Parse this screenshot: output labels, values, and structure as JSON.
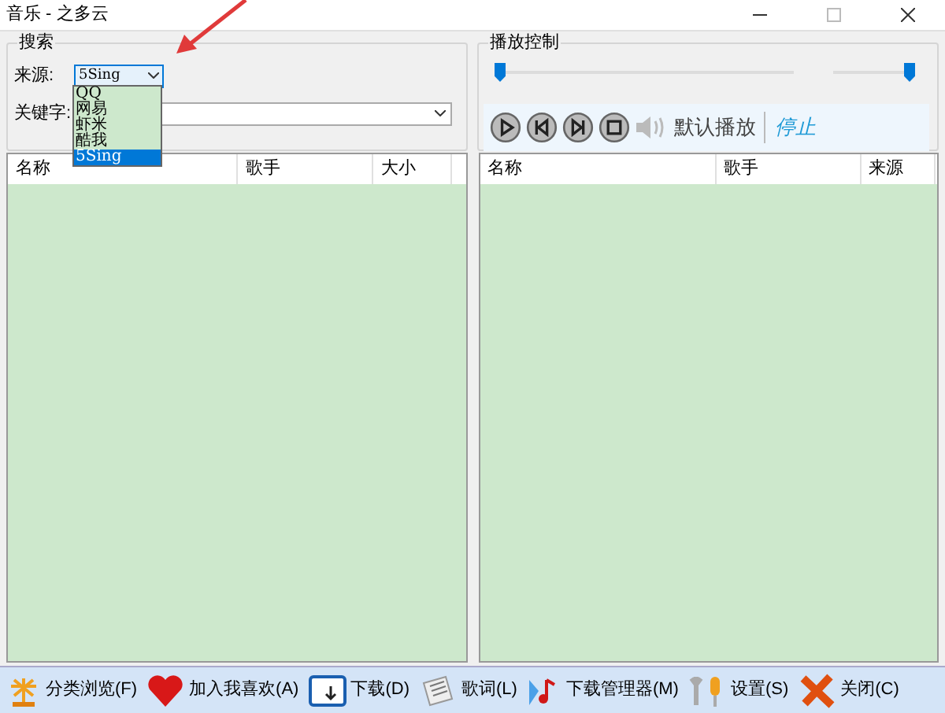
{
  "window": {
    "title": "音乐 - 之多云"
  },
  "search": {
    "title": "搜索",
    "source_label": "来源:",
    "source_value": "5Sing",
    "source_options": [
      {
        "label": "QQ",
        "selected": false
      },
      {
        "label": "网易",
        "selected": false
      },
      {
        "label": "虾米",
        "selected": false
      },
      {
        "label": "酷我",
        "selected": false
      },
      {
        "label": "5Sing",
        "selected": true
      }
    ],
    "keyword_label": "关键字:"
  },
  "playback": {
    "title": "播放控制",
    "progress": {
      "level": 0
    },
    "volume": {
      "level": 1
    },
    "buttons": [
      {
        "kind": "play"
      },
      {
        "kind": "prev"
      },
      {
        "kind": "next"
      },
      {
        "kind": "stop"
      }
    ],
    "device": "默认播放",
    "state": "停止"
  },
  "search_results": {
    "columns": [
      "名称",
      "歌手",
      "大小"
    ]
  },
  "playlist": {
    "columns": [
      "名称",
      "歌手",
      "来源"
    ]
  },
  "toolbar": [
    {
      "kind": "browse",
      "label": "分类浏览(F)"
    },
    {
      "kind": "favorite",
      "label": "加入我喜欢(A)"
    },
    {
      "kind": "download",
      "label": "下载(D)"
    },
    {
      "kind": "lyrics",
      "label": "歌词(L)"
    },
    {
      "kind": "manager",
      "label": "下载管理器(M)"
    },
    {
      "kind": "settings",
      "label": "设置(S)"
    },
    {
      "kind": "close",
      "label": "关闭(C)"
    }
  ]
}
